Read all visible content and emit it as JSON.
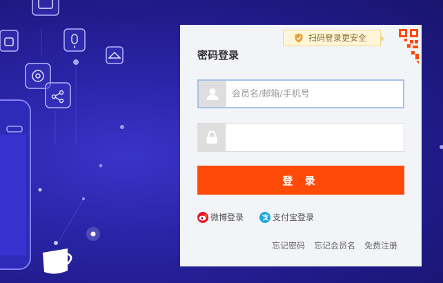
{
  "colors": {
    "accent": "#ff4a08",
    "background": "#2a25a8",
    "panel": "#f3f4f8",
    "weibo": "#e6162d",
    "alipay": "#1ba5e0"
  },
  "login": {
    "title": "密码登录",
    "qr_tip": "扫码登录更安全",
    "username": {
      "value": "",
      "placeholder": "会员名/邮箱/手机号"
    },
    "password": {
      "value": "",
      "placeholder": ""
    },
    "submit_label": "登 录",
    "third_party": [
      {
        "label": "微博登录",
        "icon": "weibo-icon"
      },
      {
        "label": "支付宝登录",
        "icon": "alipay-icon"
      }
    ],
    "links": [
      "忘记密码",
      "忘记会员名",
      "免费注册"
    ]
  }
}
